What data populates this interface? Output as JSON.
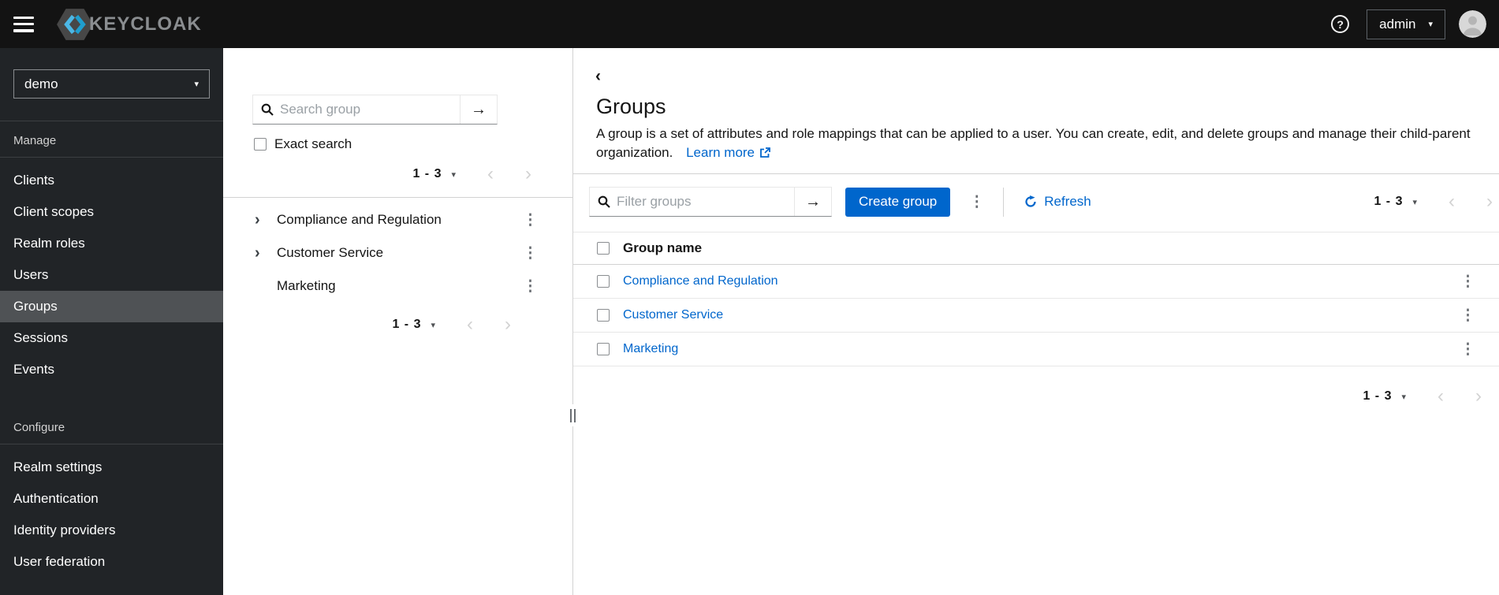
{
  "colors": {
    "primary": "#0066cc",
    "link": "#0066cc",
    "topbar_bg": "#131313",
    "sidebar_bg": "#212427",
    "active_nav_bg": "#4f5255"
  },
  "icons": {
    "caret_down": "▾",
    "chevron_left": "‹",
    "chevron_right": "›",
    "tree_expand": "›",
    "back": "‹",
    "kebab": "⋮",
    "arrow_right": "→",
    "help": "?"
  },
  "topbar": {
    "brand": "KEYCLOAK",
    "user": "admin"
  },
  "sidebar": {
    "realm": "demo",
    "manage_label": "Manage",
    "manage_items": [
      "Clients",
      "Client scopes",
      "Realm roles",
      "Users",
      "Groups",
      "Sessions",
      "Events"
    ],
    "active_item": "Groups",
    "configure_label": "Configure",
    "configure_items": [
      "Realm settings",
      "Authentication",
      "Identity providers",
      "User federation"
    ]
  },
  "tree_panel": {
    "search_placeholder": "Search group",
    "exact_search_label": "Exact search",
    "pagination_range": "1 - 3",
    "items": [
      {
        "name": "Compliance and Regulation",
        "expandable": true
      },
      {
        "name": "Customer Service",
        "expandable": true
      },
      {
        "name": "Marketing",
        "expandable": false
      }
    ]
  },
  "main": {
    "title": "Groups",
    "description": "A group is a set of attributes and role mappings that can be applied to a user. You can create, edit, and delete groups and manage their child-parent organization.",
    "learn_more_label": "Learn more",
    "toolbar": {
      "filter_placeholder": "Filter groups",
      "create_button_label": "Create group",
      "refresh_label": "Refresh"
    },
    "pagination_range": "1 - 3",
    "table": {
      "header": "Group name",
      "rows": [
        {
          "name": "Compliance and Regulation"
        },
        {
          "name": "Customer Service"
        },
        {
          "name": "Marketing"
        }
      ]
    }
  }
}
